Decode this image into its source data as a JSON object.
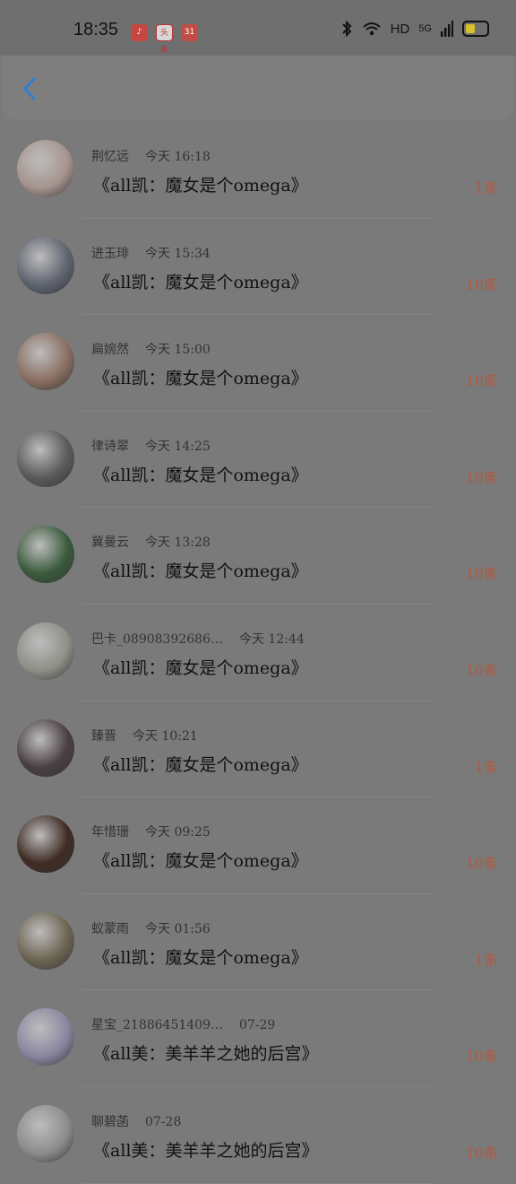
{
  "status_bar": {
    "time": "18:35",
    "notifications": [
      {
        "name": "music-app-icon",
        "glyph": "♪",
        "color": "#c5473f"
      },
      {
        "name": "toutiao-app-icon",
        "glyph": "头条",
        "color": "#d7d7d7"
      },
      {
        "name": "app-notification-icon",
        "glyph": "31",
        "color": "#c24d44"
      }
    ],
    "hd": "HD",
    "network": "5G"
  },
  "header": {
    "back_icon": "chevron-left-icon",
    "accent": "#2f7fd1"
  },
  "messages": [
    {
      "sender": "荆忆远",
      "time": "今天 16:18",
      "title": "《all凯：魔女是个omega》",
      "count": "1条",
      "avatar_color": "#a6948e"
    },
    {
      "sender": "进玉琲",
      "time": "今天 15:34",
      "title": "《all凯：魔女是个omega》",
      "count": "10条",
      "avatar_color": "#5f6470"
    },
    {
      "sender": "扁婉然",
      "time": "今天 15:00",
      "title": "《all凯：魔女是个omega》",
      "count": "10条",
      "avatar_color": "#8a6f62"
    },
    {
      "sender": "律诗翠",
      "time": "今天 14:25",
      "title": "《all凯：魔女是个omega》",
      "count": "10条",
      "avatar_color": "#5c5a5a"
    },
    {
      "sender": "冀曼云",
      "time": "今天 13:28",
      "title": "《all凯：魔女是个omega》",
      "count": "10条",
      "avatar_color": "#3b5b3c"
    },
    {
      "sender": "巴卡_08908392686…",
      "time": "今天 12:44",
      "title": "《all凯：魔女是个omega》",
      "count": "10条",
      "avatar_color": "#8f8f88"
    },
    {
      "sender": "臻晋",
      "time": "今天 10:21",
      "title": "《all凯：魔女是个omega》",
      "count": "1条",
      "avatar_color": "#4a3f45"
    },
    {
      "sender": "年惜珊",
      "time": "今天 09:25",
      "title": "《all凯：魔女是个omega》",
      "count": "10条",
      "avatar_color": "#3f2c23"
    },
    {
      "sender": "蚁蒙雨",
      "time": "今天 01:56",
      "title": "《all凯：魔女是个omega》",
      "count": "1条",
      "avatar_color": "#6d6553"
    },
    {
      "sender": "星宝_21886451409…",
      "time": "07-29",
      "title": "《all美：美羊羊之她的后宫》",
      "count": "10条",
      "avatar_color": "#8a86a0"
    },
    {
      "sender": "聊碧菡",
      "time": "07-28",
      "title": "《all美：美羊羊之她的后宫》",
      "count": "10条",
      "avatar_color": "#8c8c8c"
    }
  ]
}
